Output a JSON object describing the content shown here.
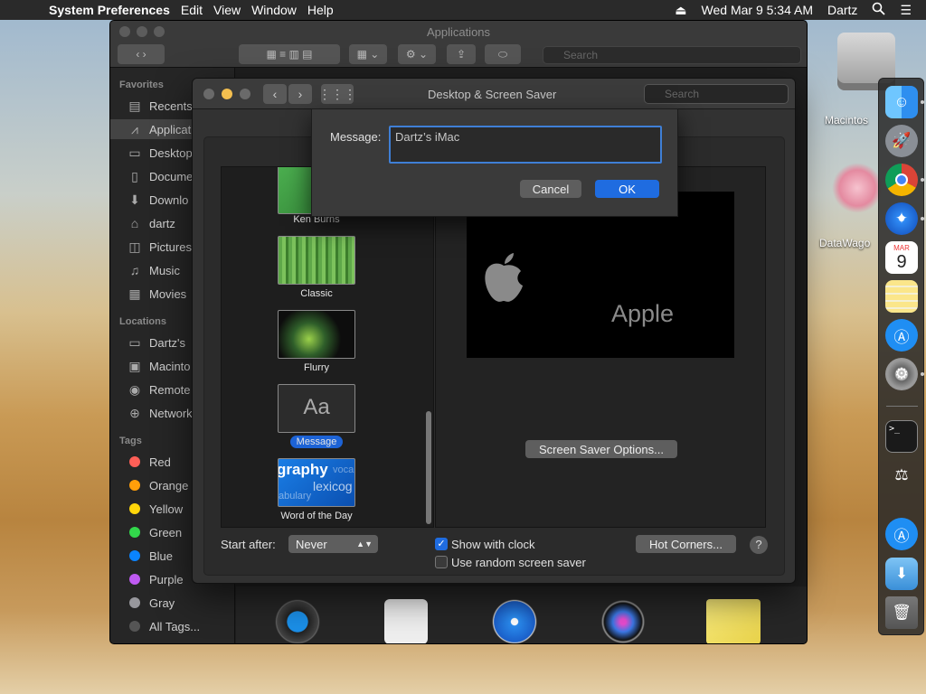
{
  "menubar": {
    "app": "System Preferences",
    "menus": [
      "Edit",
      "View",
      "Window",
      "Help"
    ],
    "clock": "Wed Mar 9  5:34 AM",
    "user": "Dartz"
  },
  "desktop": {
    "hd_label": "Macintos",
    "dw_label": "DataWago"
  },
  "finder": {
    "title": "Applications",
    "search_placeholder": "Search",
    "favorites_head": "Favorites",
    "favorites": [
      "Recents",
      "Applicati",
      "Desktop",
      "Docume",
      "Downlo",
      "dartz",
      "Pictures",
      "Music",
      "Movies"
    ],
    "locations_head": "Locations",
    "locations": [
      "Dartz's",
      "Macinto",
      "Remote",
      "Network"
    ],
    "tags_head": "Tags",
    "tags": [
      {
        "label": "Red",
        "color": "#ff5f57"
      },
      {
        "label": "Orange",
        "color": "#ff9f0a"
      },
      {
        "label": "Yellow",
        "color": "#ffd60a"
      },
      {
        "label": "Green",
        "color": "#32d74b"
      },
      {
        "label": "Blue",
        "color": "#0a84ff"
      },
      {
        "label": "Purple",
        "color": "#bf5af2"
      },
      {
        "label": "Gray",
        "color": "#98989d"
      }
    ],
    "all_tags": "All Tags..."
  },
  "prefs": {
    "title": "Desktop & Screen Saver",
    "search_placeholder": "Search",
    "savers": [
      "Ken Burns",
      "Classic",
      "Flurry",
      "Message",
      "Word of the Day"
    ],
    "preview_text": "Apple",
    "options_label": "Screen Saver Options...",
    "start_after_label": "Start after:",
    "start_after_value": "Never",
    "show_clock": "Show with clock",
    "random_saver": "Use random screen saver",
    "hot_corners": "Hot Corners...",
    "help": "?",
    "message_thumb": "Aa",
    "word_thumb": [
      "graphy",
      "lexicog",
      "abulary",
      "voca"
    ]
  },
  "sheet": {
    "label": "Message:",
    "value": "Dartz’s iMac",
    "cancel": "Cancel",
    "ok": "OK"
  },
  "dock": {
    "calendar_month": "MAR",
    "calendar_day": "9",
    "terminal": ">_"
  }
}
